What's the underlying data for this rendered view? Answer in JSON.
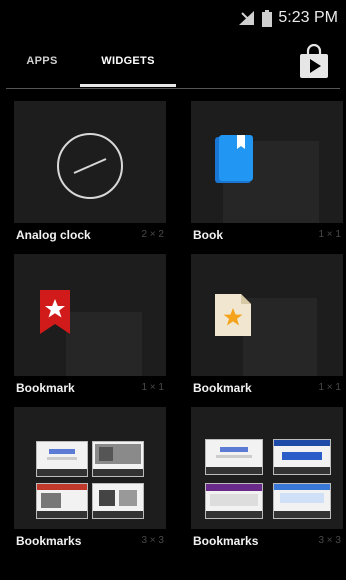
{
  "status": {
    "time": "5:23 PM"
  },
  "tabs": {
    "apps": "APPS",
    "widgets": "WIDGETS"
  },
  "widgets": [
    {
      "label": "Analog clock",
      "size": "2 × 2"
    },
    {
      "label": "Book",
      "size": "1 × 1"
    },
    {
      "label": "Bookmark",
      "size": "1 × 1"
    },
    {
      "label": "Bookmark",
      "size": "1 × 1"
    },
    {
      "label": "Bookmarks",
      "size": "3 × 3"
    },
    {
      "label": "Bookmarks",
      "size": "3 × 3"
    }
  ],
  "icons": {
    "signal": "signal-icon",
    "battery": "battery-icon",
    "store": "play-store-icon",
    "clock": "analog-clock-icon",
    "book": "book-icon",
    "bookmark_red": "bookmark-star-icon",
    "bookmark_page": "bookmark-page-icon"
  },
  "colors": {
    "background": "#000000",
    "bookmark_red": "#d11a1a",
    "book_blue": "#2196f3"
  }
}
